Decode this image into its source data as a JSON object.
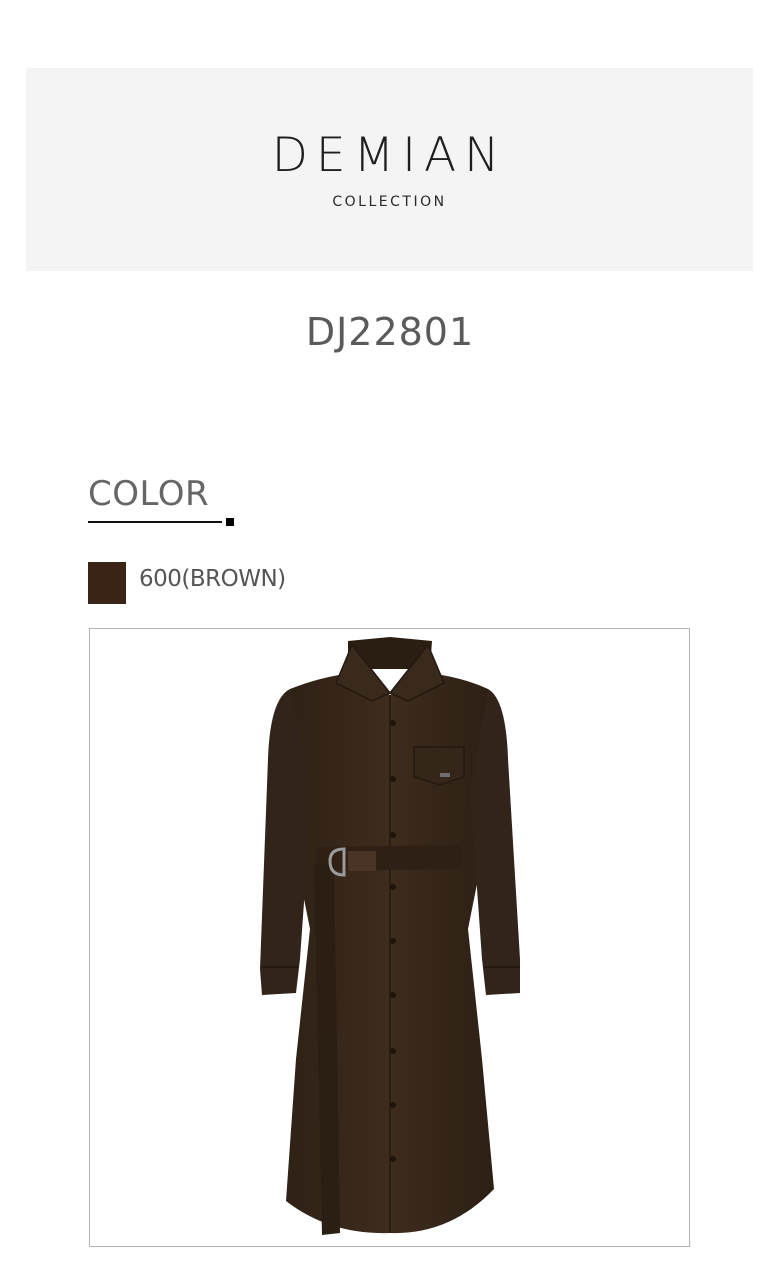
{
  "brand": {
    "name": "DEMIAN",
    "subtitle": "COLLECTION"
  },
  "product": {
    "code": "DJ22801"
  },
  "color_section": {
    "heading": "COLOR",
    "options": [
      {
        "label": "600(BROWN)",
        "swatch_color": "#3a2416"
      }
    ]
  },
  "colors": {
    "banner_bg": "#f4f4f4",
    "garment": "#3b2a1c",
    "text_gray": "#5a5a5a"
  }
}
